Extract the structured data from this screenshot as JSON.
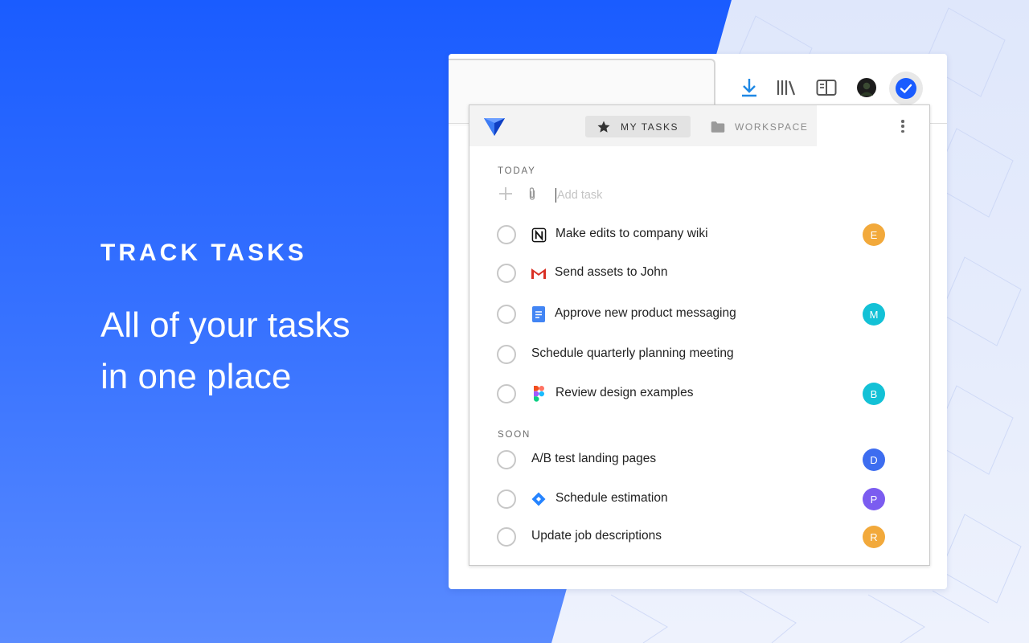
{
  "hero": {
    "label": "TRACK TASKS",
    "headline_line1": "All of your tasks",
    "headline_line2": "in one place"
  },
  "browser_toolbar": {
    "icons": [
      "download-icon",
      "library-icon",
      "reader-view-icon",
      "profile-avatar",
      "tasks-extension-icon"
    ]
  },
  "popup": {
    "tabs": [
      {
        "label": "MY TASKS",
        "icon": "star-icon",
        "active": true
      },
      {
        "label": "WORKSPACE",
        "icon": "folder-icon",
        "active": false
      }
    ],
    "sections": {
      "today": "TODAY",
      "soon": "SOON"
    },
    "add_task": {
      "placeholder": "Add task",
      "value": ""
    },
    "today_tasks": [
      {
        "title": "Make edits to company wiki",
        "app": "notion-icon",
        "assignee": "E",
        "assignee_color": "#f2a93b"
      },
      {
        "title": "Send assets to John",
        "app": "gmail-icon",
        "assignee": "",
        "assignee_color": ""
      },
      {
        "title": "Approve new product messaging",
        "app": "google-docs-icon",
        "assignee": "M",
        "assignee_color": "#13c1d6"
      },
      {
        "title": "Schedule quarterly planning meeting",
        "app": "",
        "assignee": "",
        "assignee_color": ""
      },
      {
        "title": "Review design examples",
        "app": "figma-icon",
        "assignee": "B",
        "assignee_color": "#13c1d6"
      }
    ],
    "soon_tasks": [
      {
        "title": "A/B test landing pages",
        "app": "",
        "assignee": "D",
        "assignee_color": "#3d6df0"
      },
      {
        "title": "Schedule estimation",
        "app": "jira-icon",
        "assignee": "P",
        "assignee_color": "#7b5cf0"
      },
      {
        "title": "Update job descriptions",
        "app": "",
        "assignee": "R",
        "assignee_color": "#f2a93b"
      }
    ]
  },
  "colors": {
    "brand_blue": "#1a5cff",
    "accent": "#3d7cf5"
  }
}
